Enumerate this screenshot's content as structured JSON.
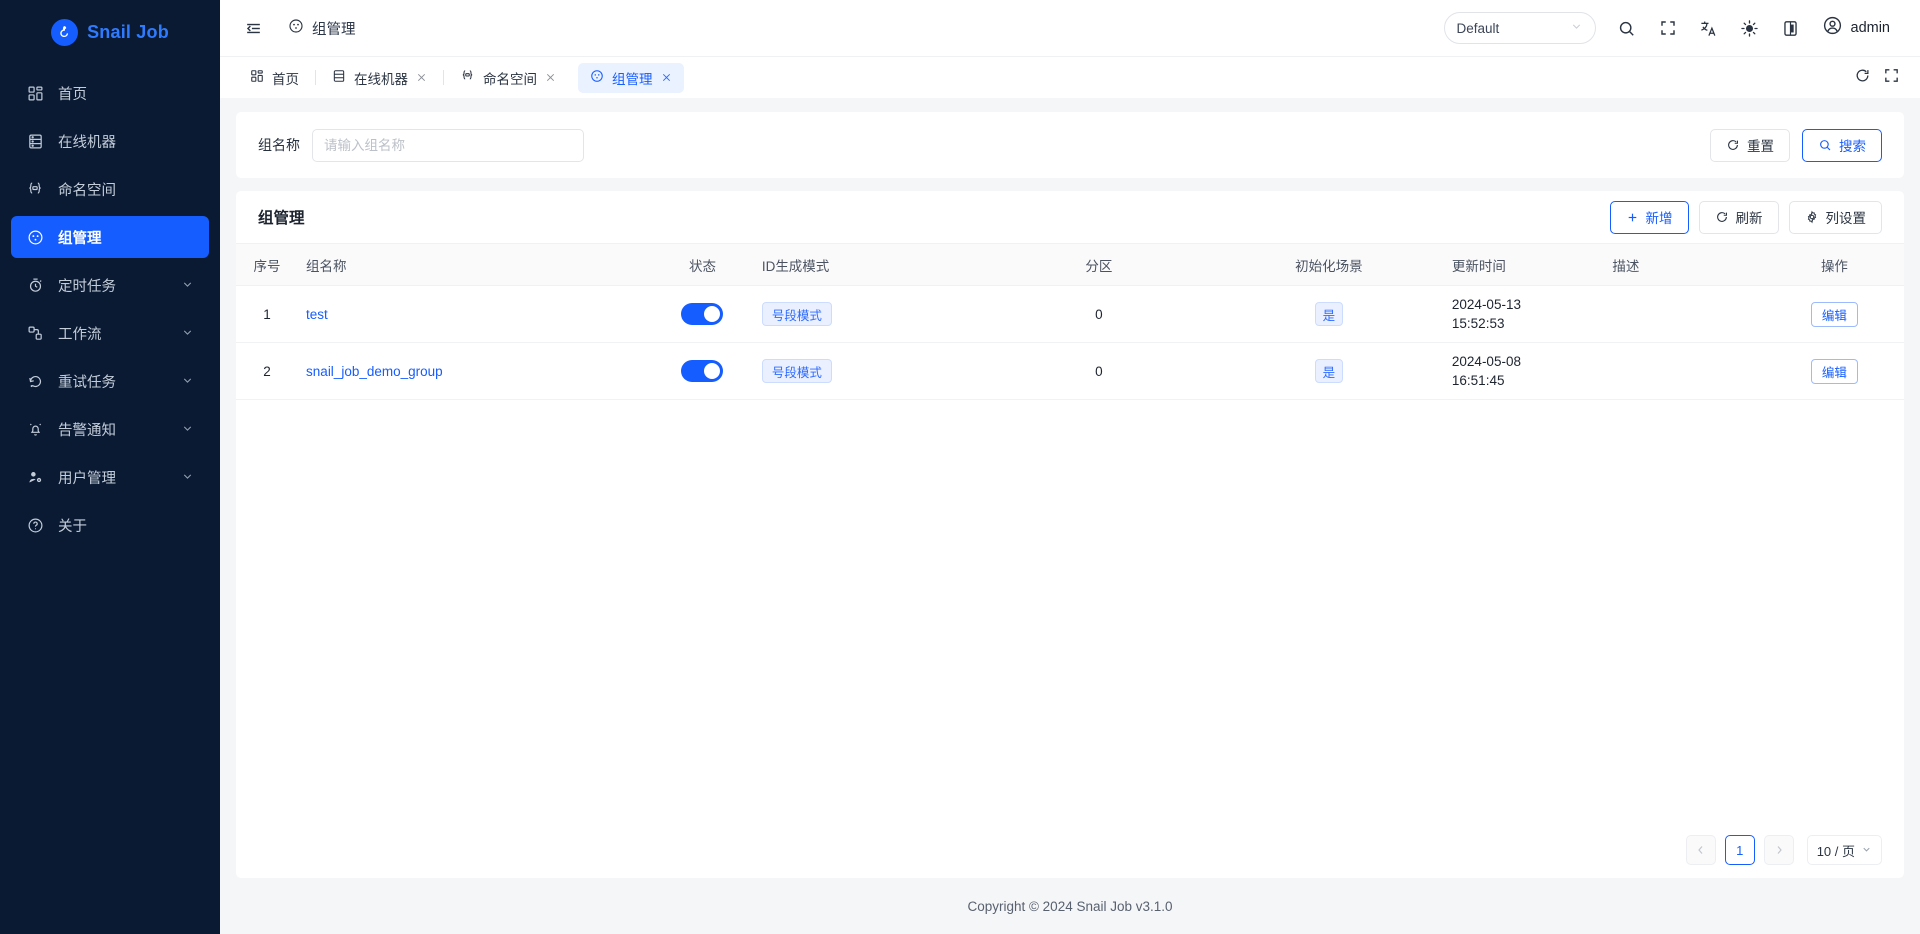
{
  "app": {
    "logo_text": "Snail Job",
    "logo_icon": "snail-logo-icon"
  },
  "sidebar": {
    "items": [
      {
        "label": "首页",
        "icon": "dashboard-icon",
        "expandable": false,
        "active": false
      },
      {
        "label": "在线机器",
        "icon": "server-icon",
        "expandable": false,
        "active": false
      },
      {
        "label": "命名空间",
        "icon": "namespace-icon",
        "expandable": false,
        "active": false
      },
      {
        "label": "组管理",
        "icon": "group-icon",
        "expandable": false,
        "active": true
      },
      {
        "label": "定时任务",
        "icon": "timer-icon",
        "expandable": true,
        "active": false
      },
      {
        "label": "工作流",
        "icon": "workflow-icon",
        "expandable": true,
        "active": false
      },
      {
        "label": "重试任务",
        "icon": "retry-icon",
        "expandable": true,
        "active": false
      },
      {
        "label": "告警通知",
        "icon": "bell-icon",
        "expandable": true,
        "active": false
      },
      {
        "label": "用户管理",
        "icon": "user-settings-icon",
        "expandable": true,
        "active": false
      },
      {
        "label": "关于",
        "icon": "question-circle-icon",
        "expandable": false,
        "active": false
      }
    ]
  },
  "topbar": {
    "collapse_icon": "collapse-sidebar-icon",
    "breadcrumb_icon": "group-icon",
    "breadcrumb": "组管理",
    "env_selected": "Default",
    "icons": [
      {
        "name": "search-icon"
      },
      {
        "name": "fullscreen-icon"
      },
      {
        "name": "language-icon"
      },
      {
        "name": "theme-light-icon"
      },
      {
        "name": "layout-settings-icon"
      }
    ],
    "user_name": "admin",
    "user_avatar_icon": "user-avatar-icon"
  },
  "tabbar": {
    "tabs": [
      {
        "label": "首页",
        "icon": "dashboard-icon",
        "closable": false,
        "active": false
      },
      {
        "label": "在线机器",
        "icon": "server-icon",
        "closable": true,
        "active": false
      },
      {
        "label": "命名空间",
        "icon": "namespace-icon",
        "closable": true,
        "active": false
      },
      {
        "label": "组管理",
        "icon": "group-icon",
        "closable": true,
        "active": true
      }
    ],
    "refresh_icon": "refresh-icon",
    "fullscreen_icon": "fullscreen-icon"
  },
  "search": {
    "label": "组名称",
    "placeholder": "请输入组名称",
    "value": "",
    "reset_label": "重置",
    "reset_icon": "refresh-icon",
    "search_label": "搜索",
    "search_icon": "search-icon"
  },
  "card": {
    "title": "组管理",
    "add_label": "新增",
    "add_icon": "plus-icon",
    "refresh_label": "刷新",
    "refresh_icon": "refresh-icon",
    "columns_label": "列设置",
    "columns_icon": "gear-icon"
  },
  "table": {
    "columns": [
      "序号",
      "组名称",
      "状态",
      "ID生成模式",
      "分区",
      "初始化场景",
      "更新时间",
      "描述",
      "操作"
    ],
    "rows": [
      {
        "index": "1",
        "name": "test",
        "enabled": true,
        "mode": "号段模式",
        "partition": "0",
        "init_scene": "是",
        "update_date": "2024-05-13",
        "update_time": "15:52:53",
        "description": "",
        "action": "编辑"
      },
      {
        "index": "2",
        "name": "snail_job_demo_group",
        "enabled": true,
        "mode": "号段模式",
        "partition": "0",
        "init_scene": "是",
        "update_date": "2024-05-08",
        "update_time": "16:51:45",
        "description": "",
        "action": "编辑"
      }
    ]
  },
  "pagination": {
    "prev_icon": "chevron-left-icon",
    "next_icon": "chevron-right-icon",
    "current_page": "1",
    "page_size": "10 / 页"
  },
  "footer": {
    "text": "Copyright © 2024 Snail Job v3.1.0"
  },
  "colors": {
    "accent": "#165dff",
    "sidebar_bg": "#0b1a33",
    "page_bg": "#f5f6f8"
  }
}
